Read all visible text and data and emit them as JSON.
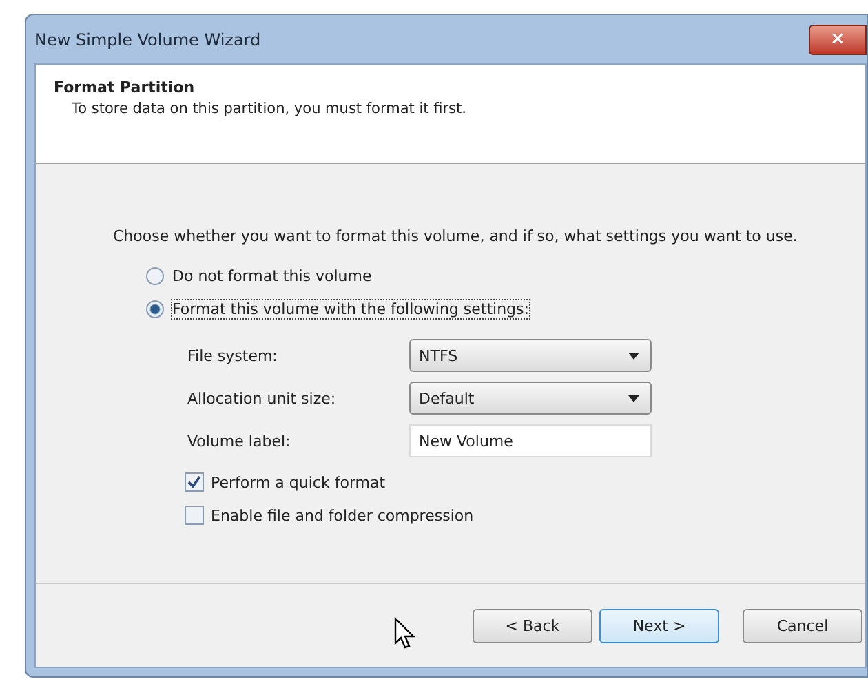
{
  "window": {
    "title": "New Simple Volume Wizard",
    "close": "×"
  },
  "header": {
    "title": "Format Partition",
    "subtitle": "To store data on this partition, you must format it first."
  },
  "intro": "Choose whether you want to format this volume, and if so, what settings you want to use.",
  "options": [
    {
      "label": "Do not format this volume",
      "selected": false
    },
    {
      "label": "Format this volume with the following settings:",
      "selected": true
    }
  ],
  "settings": [
    {
      "kind": "dropdown",
      "label": "File system:",
      "value": "NTFS"
    },
    {
      "kind": "dropdown",
      "label": "Allocation unit size:",
      "value": "Default"
    },
    {
      "kind": "text",
      "label": "Volume label:",
      "value": "New Volume"
    }
  ],
  "checks": [
    {
      "label": "Perform a quick format",
      "checked": true
    },
    {
      "label": "Enable file and folder compression",
      "checked": false
    }
  ],
  "buttons": [
    {
      "label": "< Back",
      "focused": false
    },
    {
      "label": "Next >",
      "focused": true
    },
    {
      "label": "Cancel",
      "focused": false
    }
  ]
}
